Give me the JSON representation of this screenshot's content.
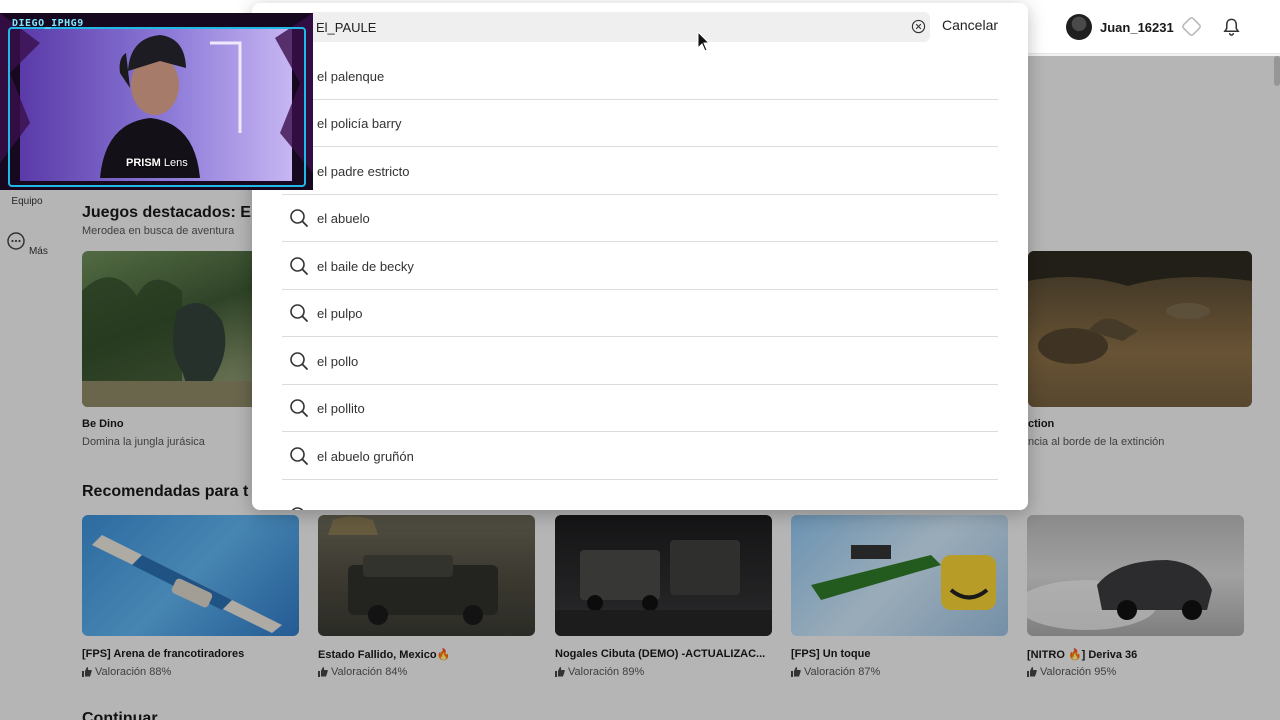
{
  "header": {
    "username": "Juan_16231"
  },
  "sidebar": {
    "items": [
      {
        "label": "Equipo",
        "icon": "team-icon"
      },
      {
        "label": "Más",
        "icon": "more-icon"
      }
    ]
  },
  "featured": {
    "title": "Juegos destacados: E",
    "subtitle": "Merodea en busca de aventura",
    "cards": [
      {
        "title": "Be Dino",
        "subtitle": "Domina la jungla jurásica"
      },
      {
        "title": "ction",
        "subtitle": "ncia al borde de la extinción"
      }
    ]
  },
  "recommended": {
    "title": "Recomendadas para t",
    "cards": [
      {
        "title": "[FPS] Arena de francotiradores",
        "rating": "Valoración 88%"
      },
      {
        "title": "Estado Fallido, Mexico🔥",
        "rating": "Valoración 84%"
      },
      {
        "title": "Nogales Cibuta (DEMO) -ACTUALIZAC...",
        "rating": "Valoración 89%"
      },
      {
        "title": "[FPS] Un toque",
        "rating": "Valoración 87%"
      },
      {
        "title": "[NITRO 🔥] Deriva 36",
        "rating": "Valoración 95%"
      }
    ]
  },
  "continue": {
    "title": "Continuar"
  },
  "search": {
    "value": "El_PAULE",
    "cancel_label": "Cancelar",
    "suggestions": [
      {
        "text": "el palenque"
      },
      {
        "text": "el policía barry"
      },
      {
        "text": "el padre estricto"
      },
      {
        "text": "el abuelo"
      },
      {
        "text": "el baile de becky"
      },
      {
        "text": "el pulpo"
      },
      {
        "text": "el pollo"
      },
      {
        "text": "el pollito"
      },
      {
        "text": "el abuelo gruñón"
      }
    ]
  },
  "webcam": {
    "name": "DIEGO_IPHG9",
    "lens_brand": "PRISM",
    "lens_word": "Lens"
  },
  "colors": {
    "accent_cyan": "#22b8e6",
    "dim_overlay": "rgba(0,0,0,0.25)"
  }
}
